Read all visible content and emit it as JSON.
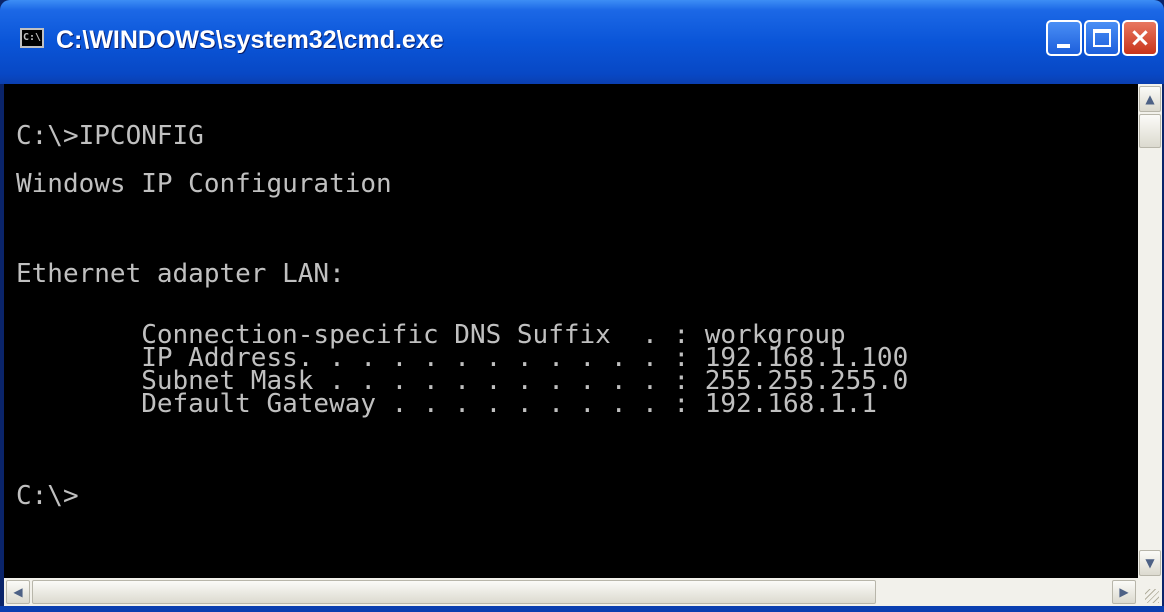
{
  "window": {
    "title": "C:\\WINDOWS\\system32\\cmd.exe",
    "icon": "cmd-icon",
    "icon_label": "C:\\"
  },
  "console": {
    "lines": [
      "C:\\>IPCONFIG",
      "Windows IP Configuration",
      "Ethernet adapter LAN:",
      "        Connection-specific DNS Suffix  . : workgroup",
      "        IP Address. . . . . . . . . . . . : 192.168.1.100",
      "        Subnet Mask . . . . . . . . . . . : 255.255.255.0",
      "        Default Gateway . . . . . . . . . : 192.168.1.1",
      "C:\\>"
    ]
  },
  "scrollbars": {
    "up_arrow": "▲",
    "down_arrow": "▼",
    "left_arrow": "◀",
    "right_arrow": "▶"
  },
  "colors": {
    "titlebar": "#0a55d8",
    "console_bg": "#000000",
    "console_text": "#c0c0c0"
  }
}
